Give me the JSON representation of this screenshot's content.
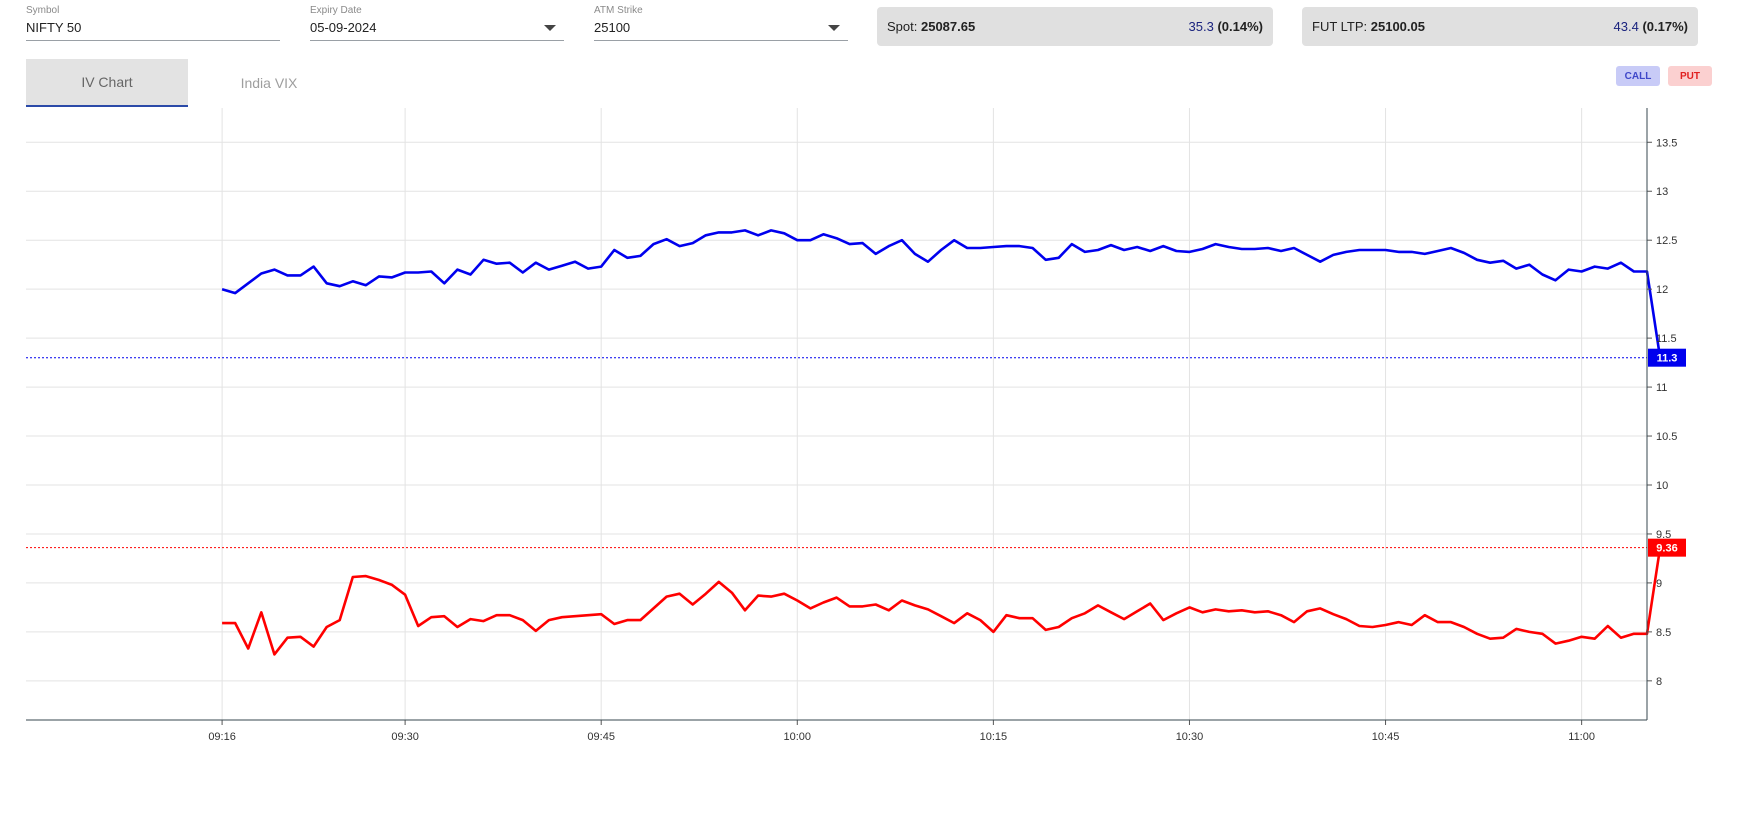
{
  "controls": {
    "symbol": {
      "label": "Symbol",
      "value": "NIFTY 50"
    },
    "expiry": {
      "label": "Expiry Date",
      "value": "05-09-2024"
    },
    "strike": {
      "label": "ATM Strike",
      "value": "25100"
    }
  },
  "spot": {
    "label": "Spot:",
    "value": "25087.65",
    "change": "35.3",
    "pct": "(0.14%)"
  },
  "fut": {
    "label": "FUT LTP:",
    "value": "25100.05",
    "change": "43.4",
    "pct": "(0.17%)"
  },
  "tabs": [
    {
      "label": "IV Chart",
      "active": true
    },
    {
      "label": "India VIX",
      "active": false
    }
  ],
  "legend": {
    "call": "CALL",
    "put": "PUT"
  },
  "colors": {
    "call": "#0000ee",
    "put": "#ff0000",
    "call_pill_bg": "#c8cbf7",
    "put_pill_bg": "#fbd0d0"
  },
  "chart_data": {
    "type": "line",
    "x_range": [
      "09:01",
      "11:05"
    ],
    "y_range": [
      7.6,
      13.85
    ],
    "x_ticks": [
      "09:16",
      "09:30",
      "09:45",
      "10:00",
      "10:15",
      "10:30",
      "10:45",
      "11:00"
    ],
    "y_ticks": [
      8,
      8.5,
      9,
      9.5,
      10,
      10.5,
      11,
      11.5,
      12,
      12.5,
      13,
      13.5
    ],
    "grid": true,
    "series": [
      {
        "name": "CALL",
        "color": "#0000ee",
        "last_value": "11.3",
        "points": [
          [
            "09:16",
            12.0
          ],
          [
            "09:17",
            11.96
          ],
          [
            "09:18",
            12.06
          ],
          [
            "09:19",
            12.16
          ],
          [
            "09:20",
            12.2
          ],
          [
            "09:21",
            12.14
          ],
          [
            "09:22",
            12.14
          ],
          [
            "09:23",
            12.23
          ],
          [
            "09:24",
            12.06
          ],
          [
            "09:25",
            12.03
          ],
          [
            "09:26",
            12.08
          ],
          [
            "09:27",
            12.04
          ],
          [
            "09:28",
            12.13
          ],
          [
            "09:29",
            12.12
          ],
          [
            "09:30",
            12.17
          ],
          [
            "09:31",
            12.17
          ],
          [
            "09:32",
            12.18
          ],
          [
            "09:33",
            12.06
          ],
          [
            "09:34",
            12.2
          ],
          [
            "09:35",
            12.15
          ],
          [
            "09:36",
            12.3
          ],
          [
            "09:37",
            12.26
          ],
          [
            "09:38",
            12.27
          ],
          [
            "09:39",
            12.17
          ],
          [
            "09:40",
            12.27
          ],
          [
            "09:41",
            12.2
          ],
          [
            "09:42",
            12.24
          ],
          [
            "09:43",
            12.28
          ],
          [
            "09:44",
            12.21
          ],
          [
            "09:45",
            12.23
          ],
          [
            "09:46",
            12.4
          ],
          [
            "09:47",
            12.32
          ],
          [
            "09:48",
            12.34
          ],
          [
            "09:49",
            12.46
          ],
          [
            "09:50",
            12.51
          ],
          [
            "09:51",
            12.44
          ],
          [
            "09:52",
            12.47
          ],
          [
            "09:53",
            12.55
          ],
          [
            "09:54",
            12.58
          ],
          [
            "09:55",
            12.58
          ],
          [
            "09:56",
            12.6
          ],
          [
            "09:57",
            12.55
          ],
          [
            "09:58",
            12.6
          ],
          [
            "09:59",
            12.57
          ],
          [
            "10:00",
            12.5
          ],
          [
            "10:01",
            12.5
          ],
          [
            "10:02",
            12.56
          ],
          [
            "10:03",
            12.52
          ],
          [
            "10:04",
            12.46
          ],
          [
            "10:05",
            12.47
          ],
          [
            "10:06",
            12.36
          ],
          [
            "10:07",
            12.44
          ],
          [
            "10:08",
            12.5
          ],
          [
            "10:09",
            12.36
          ],
          [
            "10:10",
            12.28
          ],
          [
            "10:11",
            12.4
          ],
          [
            "10:12",
            12.5
          ],
          [
            "10:13",
            12.42
          ],
          [
            "10:14",
            12.42
          ],
          [
            "10:15",
            12.43
          ],
          [
            "10:16",
            12.44
          ],
          [
            "10:17",
            12.44
          ],
          [
            "10:18",
            12.42
          ],
          [
            "10:19",
            12.3
          ],
          [
            "10:20",
            12.32
          ],
          [
            "10:21",
            12.46
          ],
          [
            "10:22",
            12.38
          ],
          [
            "10:23",
            12.4
          ],
          [
            "10:24",
            12.45
          ],
          [
            "10:25",
            12.4
          ],
          [
            "10:26",
            12.43
          ],
          [
            "10:27",
            12.39
          ],
          [
            "10:28",
            12.44
          ],
          [
            "10:29",
            12.39
          ],
          [
            "10:30",
            12.38
          ],
          [
            "10:31",
            12.41
          ],
          [
            "10:32",
            12.46
          ],
          [
            "10:33",
            12.43
          ],
          [
            "10:34",
            12.41
          ],
          [
            "10:35",
            12.41
          ],
          [
            "10:36",
            12.42
          ],
          [
            "10:37",
            12.39
          ],
          [
            "10:38",
            12.42
          ],
          [
            "10:39",
            12.35
          ],
          [
            "10:40",
            12.28
          ],
          [
            "10:41",
            12.35
          ],
          [
            "10:42",
            12.38
          ],
          [
            "10:43",
            12.4
          ],
          [
            "10:44",
            12.4
          ],
          [
            "10:45",
            12.4
          ],
          [
            "10:46",
            12.38
          ],
          [
            "10:47",
            12.38
          ],
          [
            "10:48",
            12.36
          ],
          [
            "10:49",
            12.39
          ],
          [
            "10:50",
            12.42
          ],
          [
            "10:51",
            12.37
          ],
          [
            "10:52",
            12.3
          ],
          [
            "10:53",
            12.27
          ],
          [
            "10:54",
            12.29
          ],
          [
            "10:55",
            12.21
          ],
          [
            "10:56",
            12.25
          ],
          [
            "10:57",
            12.15
          ],
          [
            "10:58",
            12.09
          ],
          [
            "10:59",
            12.2
          ],
          [
            "11:00",
            12.18
          ],
          [
            "11:01",
            12.23
          ],
          [
            "11:02",
            12.21
          ],
          [
            "11:03",
            12.27
          ],
          [
            "11:04",
            12.18
          ],
          [
            "11:05",
            12.18
          ],
          [
            "11:06",
            11.3
          ]
        ]
      },
      {
        "name": "PUT",
        "color": "#ff0000",
        "last_value": "9.36",
        "points": [
          [
            "09:16",
            8.59
          ],
          [
            "09:17",
            8.59
          ],
          [
            "09:18",
            8.33
          ],
          [
            "09:19",
            8.7
          ],
          [
            "09:20",
            8.27
          ],
          [
            "09:21",
            8.44
          ],
          [
            "09:22",
            8.45
          ],
          [
            "09:23",
            8.35
          ],
          [
            "09:24",
            8.55
          ],
          [
            "09:25",
            8.62
          ],
          [
            "09:26",
            9.06
          ],
          [
            "09:27",
            9.07
          ],
          [
            "09:28",
            9.03
          ],
          [
            "09:29",
            8.98
          ],
          [
            "09:30",
            8.88
          ],
          [
            "09:31",
            8.56
          ],
          [
            "09:32",
            8.65
          ],
          [
            "09:33",
            8.66
          ],
          [
            "09:34",
            8.55
          ],
          [
            "09:35",
            8.63
          ],
          [
            "09:36",
            8.61
          ],
          [
            "09:37",
            8.67
          ],
          [
            "09:38",
            8.67
          ],
          [
            "09:39",
            8.62
          ],
          [
            "09:40",
            8.51
          ],
          [
            "09:41",
            8.62
          ],
          [
            "09:42",
            8.65
          ],
          [
            "09:43",
            8.66
          ],
          [
            "09:44",
            8.67
          ],
          [
            "09:45",
            8.68
          ],
          [
            "09:46",
            8.58
          ],
          [
            "09:47",
            8.62
          ],
          [
            "09:48",
            8.62
          ],
          [
            "09:49",
            8.74
          ],
          [
            "09:50",
            8.86
          ],
          [
            "09:51",
            8.89
          ],
          [
            "09:52",
            8.78
          ],
          [
            "09:53",
            8.89
          ],
          [
            "09:54",
            9.01
          ],
          [
            "09:55",
            8.9
          ],
          [
            "09:56",
            8.72
          ],
          [
            "09:57",
            8.87
          ],
          [
            "09:58",
            8.86
          ],
          [
            "09:59",
            8.89
          ],
          [
            "10:00",
            8.82
          ],
          [
            "10:01",
            8.74
          ],
          [
            "10:02",
            8.8
          ],
          [
            "10:03",
            8.85
          ],
          [
            "10:04",
            8.76
          ],
          [
            "10:05",
            8.76
          ],
          [
            "10:06",
            8.78
          ],
          [
            "10:07",
            8.72
          ],
          [
            "10:08",
            8.82
          ],
          [
            "10:09",
            8.77
          ],
          [
            "10:10",
            8.73
          ],
          [
            "10:11",
            8.66
          ],
          [
            "10:12",
            8.59
          ],
          [
            "10:13",
            8.69
          ],
          [
            "10:14",
            8.62
          ],
          [
            "10:15",
            8.5
          ],
          [
            "10:16",
            8.67
          ],
          [
            "10:17",
            8.64
          ],
          [
            "10:18",
            8.64
          ],
          [
            "10:19",
            8.52
          ],
          [
            "10:20",
            8.55
          ],
          [
            "10:21",
            8.64
          ],
          [
            "10:22",
            8.69
          ],
          [
            "10:23",
            8.77
          ],
          [
            "10:24",
            8.7
          ],
          [
            "10:25",
            8.63
          ],
          [
            "10:26",
            8.71
          ],
          [
            "10:27",
            8.79
          ],
          [
            "10:28",
            8.62
          ],
          [
            "10:29",
            8.69
          ],
          [
            "10:30",
            8.75
          ],
          [
            "10:31",
            8.7
          ],
          [
            "10:32",
            8.73
          ],
          [
            "10:33",
            8.71
          ],
          [
            "10:34",
            8.72
          ],
          [
            "10:35",
            8.7
          ],
          [
            "10:36",
            8.71
          ],
          [
            "10:37",
            8.67
          ],
          [
            "10:38",
            8.6
          ],
          [
            "10:39",
            8.71
          ],
          [
            "10:40",
            8.74
          ],
          [
            "10:41",
            8.68
          ],
          [
            "10:42",
            8.63
          ],
          [
            "10:43",
            8.56
          ],
          [
            "10:44",
            8.55
          ],
          [
            "10:45",
            8.57
          ],
          [
            "10:46",
            8.6
          ],
          [
            "10:47",
            8.57
          ],
          [
            "10:48",
            8.67
          ],
          [
            "10:49",
            8.6
          ],
          [
            "10:50",
            8.6
          ],
          [
            "10:51",
            8.55
          ],
          [
            "10:52",
            8.48
          ],
          [
            "10:53",
            8.43
          ],
          [
            "10:54",
            8.44
          ],
          [
            "10:55",
            8.53
          ],
          [
            "10:56",
            8.5
          ],
          [
            "10:57",
            8.48
          ],
          [
            "10:58",
            8.38
          ],
          [
            "10:59",
            8.41
          ],
          [
            "11:00",
            8.45
          ],
          [
            "11:01",
            8.43
          ],
          [
            "11:02",
            8.56
          ],
          [
            "11:03",
            8.44
          ],
          [
            "11:04",
            8.48
          ],
          [
            "11:05",
            8.48
          ],
          [
            "11:06",
            9.36
          ]
        ]
      }
    ]
  }
}
